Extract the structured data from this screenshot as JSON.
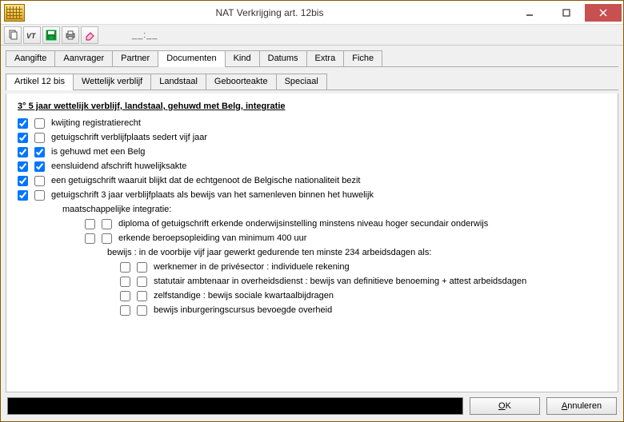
{
  "window": {
    "title": "NAT Verkrijging art. 12bis"
  },
  "toolbar": {
    "time_placeholder": "__:__"
  },
  "tabs_main": [
    "Aangifte",
    "Aanvrager",
    "Partner",
    "Documenten",
    "Kind",
    "Datums",
    "Extra",
    "Fiche"
  ],
  "tabs_main_active": 3,
  "tabs_sub": [
    "Artikel 12 bis",
    "Wettelijk verblijf",
    "Landstaal",
    "Geboorteakte",
    "Speciaal"
  ],
  "tabs_sub_active": 0,
  "section": {
    "title": "3°   5 jaar wettelijk verblijf, landstaal, gehuwd met Belg, integratie",
    "rows": [
      {
        "c1": true,
        "c2": false,
        "label": "kwijting registratierecht"
      },
      {
        "c1": true,
        "c2": false,
        "label": "getuigschrift verblijfplaats sedert vijf jaar"
      },
      {
        "c1": true,
        "c2": true,
        "label": "is gehuwd met een Belg"
      },
      {
        "c1": true,
        "c2": true,
        "label": "eensluidend afschrift huwelijksakte"
      },
      {
        "c1": true,
        "c2": false,
        "label": "een getuigschrift waaruit blijkt dat de echtgenoot de Belgische nationaliteit bezit"
      },
      {
        "c1": true,
        "c2": false,
        "label": "getuigschrift 3 jaar verblijfplaats als bewijs van het samenleven binnen het huwelijk"
      }
    ],
    "integration_label": "maatschappelijke integratie:",
    "integration_rows": [
      {
        "c1": false,
        "c2": false,
        "label": "diploma of getuigschrift erkende onderwijsinstelling minstens niveau hoger secundair onderwijs"
      },
      {
        "c1": false,
        "c2": false,
        "label": "erkende beroepsopleiding van minimum 400 uur"
      }
    ],
    "proof_label": "bewijs : in de voorbije vijf jaar gewerkt gedurende ten minste 234 arbeidsdagen als:",
    "proof_rows": [
      {
        "c1": false,
        "c2": false,
        "label": "werknemer in de privésector : individuele rekening"
      },
      {
        "c1": false,
        "c2": false,
        "label": "statutair ambtenaar in overheidsdienst : bewijs van definitieve benoeming + attest arbeidsdagen"
      },
      {
        "c1": false,
        "c2": false,
        "label": "zelfstandige : bewijs sociale kwartaalbijdragen"
      },
      {
        "c1": false,
        "c2": false,
        "label": "bewijs inburgeringscursus bevoegde overheid"
      }
    ]
  },
  "footer": {
    "ok": "OK",
    "cancel": "Annuleren"
  }
}
